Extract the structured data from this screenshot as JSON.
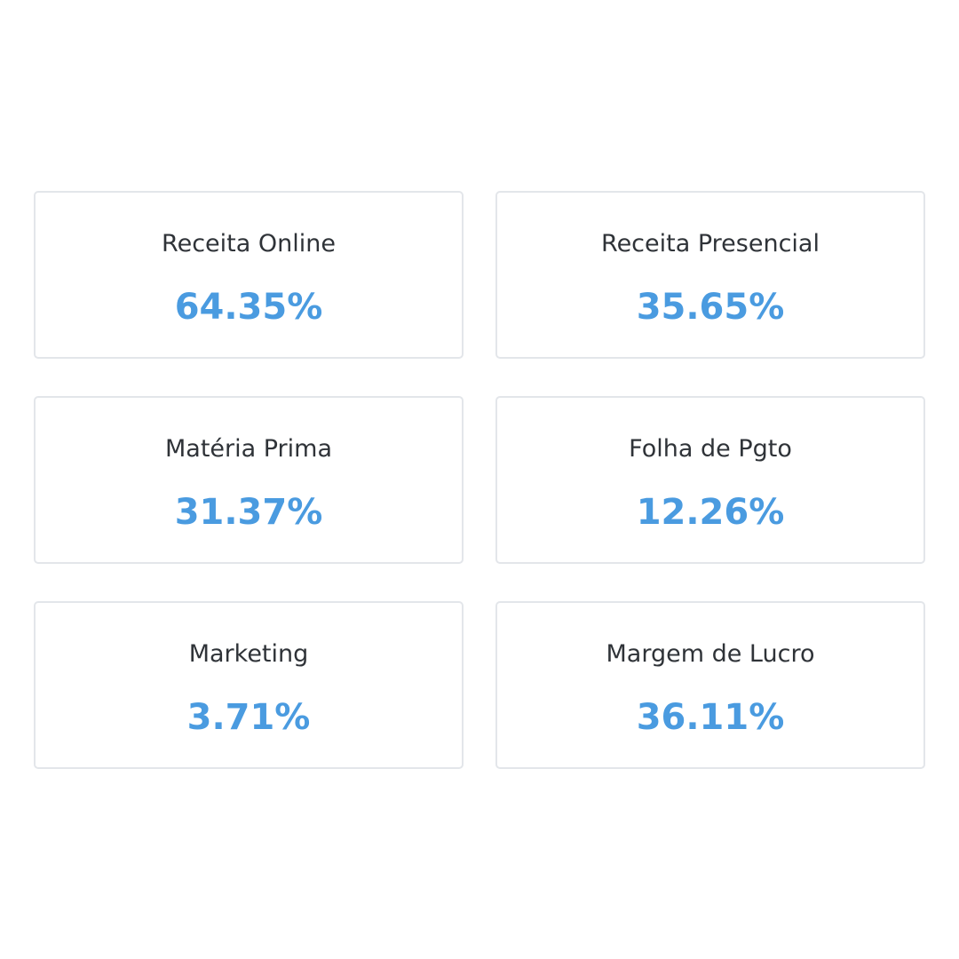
{
  "accent_color": "#4a9be0",
  "metrics": [
    {
      "label": "Receita Online",
      "value": "64.35%"
    },
    {
      "label": "Receita Presencial",
      "value": "35.65%"
    },
    {
      "label": "Matéria Prima",
      "value": "31.37%"
    },
    {
      "label": "Folha de Pgto",
      "value": "12.26%"
    },
    {
      "label": "Marketing",
      "value": "3.71%"
    },
    {
      "label": "Margem de Lucro",
      "value": "36.11%"
    }
  ]
}
